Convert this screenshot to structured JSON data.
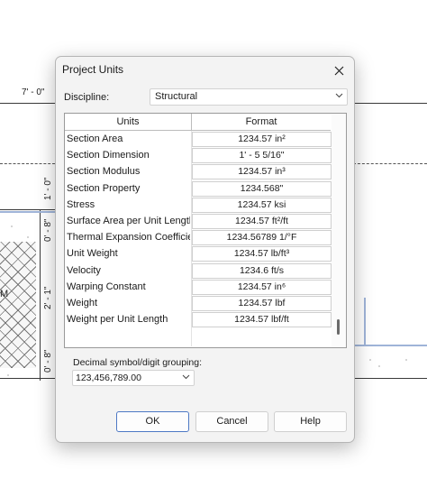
{
  "background": {
    "dim_top": "7' - 0\"",
    "dim_left_1": "1' - 0\"",
    "dim_left_2": "0' - 8\"",
    "dim_left_3": "2' - 1\"",
    "dim_left_4": "0' - 8\"",
    "left_letter": "M"
  },
  "dialog": {
    "title": "Project Units",
    "discipline_label": "Discipline:",
    "discipline_value": "Structural",
    "table_headers": {
      "units": "Units",
      "format": "Format"
    },
    "rows": [
      {
        "name": "Section Area",
        "format": "1234.57 in²"
      },
      {
        "name": "Section Dimension",
        "format": "1' - 5 5/16\""
      },
      {
        "name": "Section Modulus",
        "format": "1234.57 in³"
      },
      {
        "name": "Section Property",
        "format": "1234.568\""
      },
      {
        "name": "Stress",
        "format": "1234.57 ksi"
      },
      {
        "name": "Surface Area per Unit Length",
        "format": "1234.57 ft²/ft"
      },
      {
        "name": "Thermal Expansion Coefficie",
        "format": "1234.56789 1/°F"
      },
      {
        "name": "Unit Weight",
        "format": "1234.57 lb/ft³"
      },
      {
        "name": "Velocity",
        "format": "1234.6 ft/s"
      },
      {
        "name": "Warping Constant",
        "format": "1234.57 in⁶"
      },
      {
        "name": "Weight",
        "format": "1234.57 lbf"
      },
      {
        "name": "Weight per Unit Length",
        "format": "1234.57 lbf/ft"
      }
    ],
    "decimal_label": "Decimal symbol/digit grouping:",
    "decimal_value": "123,456,789.00",
    "buttons": {
      "ok": "OK",
      "cancel": "Cancel",
      "help": "Help"
    }
  }
}
